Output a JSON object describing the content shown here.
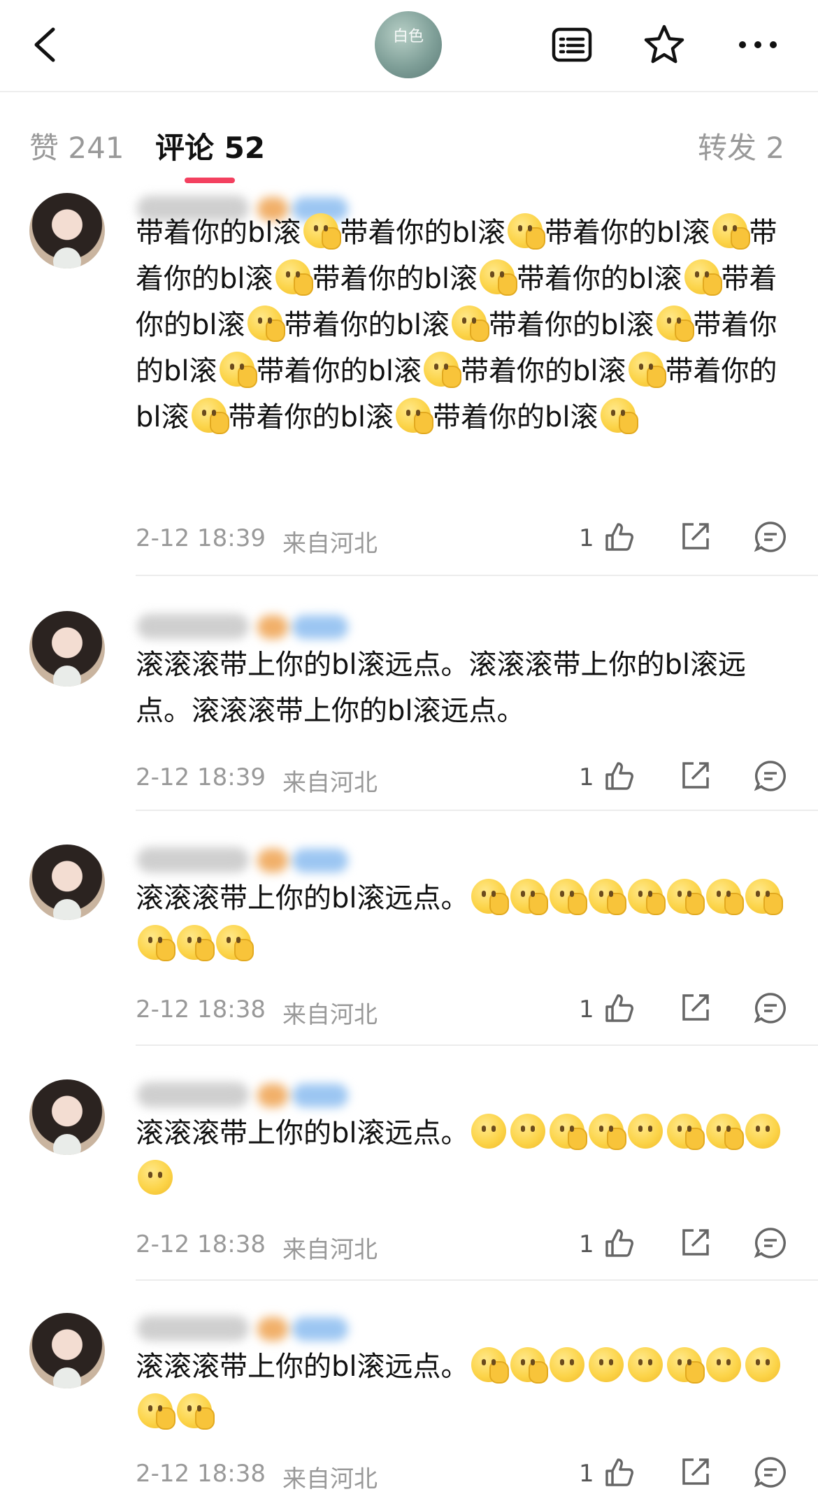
{
  "tabs": [
    {
      "label": "赞 241"
    },
    {
      "label": "评论 52"
    },
    {
      "label": "转发 2"
    }
  ],
  "logo_text": "白色",
  "icons": {
    "back": "back-arrow-icon",
    "list": "list-icon",
    "star": "star-icon",
    "more": "more-icon",
    "like": "thumbs-up-icon",
    "share": "share-icon",
    "reply": "reply-icon"
  },
  "comments": [
    {
      "text": "带着你的bl滚🫢带着你的bl滚🫢带着你的bl滚🫢带着你的bl滚🫢带着你的bl滚🫢带着你的bl滚🫢带着你的bl滚🫢带着你的bl滚🫢带着你的bl滚🫢带着你的bl滚🫢带着你的bl滚🫢带着你的bl滚🫢带着你的bl滚🫢带着你的bl滚🫢带着你的bl滚🫢",
      "time": "2-12 18:39",
      "location": "来自河北",
      "likes": "1"
    },
    {
      "text": "滚滚滚带上你的bl滚远点。滚滚滚带上你的bl滚远点。滚滚滚带上你的bl滚远点。",
      "time": "2-12 18:39",
      "location": "来自河北",
      "likes": "1"
    },
    {
      "text": "滚滚滚带上你的bl滚远点。🫢🫢🫢🫢🫢🫢🫢🫢🫢🫢🫢",
      "time": "2-12 18:38",
      "location": "来自河北",
      "likes": "1"
    },
    {
      "text": "滚滚滚带上你的bl滚远点。🙂🙂🫢🫢🙂🫢🫢🙂🙂",
      "time": "2-12 18:38",
      "location": "来自河北",
      "likes": "1"
    },
    {
      "text": "滚滚滚带上你的bl滚远点。🫢🫢🙂🙂🙂🫢🙂🙂🫢🫢",
      "time": "2-12 18:38",
      "location": "来自河北",
      "likes": "1"
    }
  ],
  "accent_color": "#f3405f"
}
